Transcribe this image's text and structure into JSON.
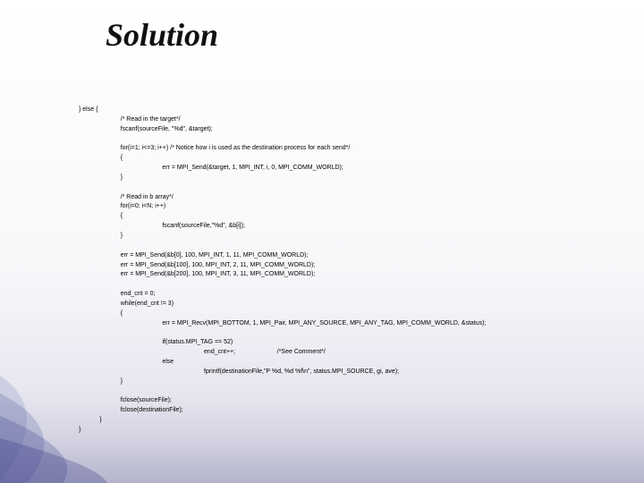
{
  "title": "Solution",
  "code": {
    "l01": "} else {",
    "l02": "/* Read in the target*/",
    "l03": "fscanf(sourceFile, \"%d\", &target);",
    "l04": "for(i=1; i<=3; i++) /* Notice how i is used as the destination process for each send*/",
    "l05": "{",
    "l06": "err = MPI_Send(&target, 1, MPI_INT, i, 0, MPI_COMM_WORLD);",
    "l07": "}",
    "l08": "/* Read in b array*/",
    "l09": "for(i=0; i<N; i++)",
    "l10": "{",
    "l11": "fscanf(sourceFile,\"%d\", &b[i]);",
    "l12": "}",
    "l13": "err = MPI_Send(&b[0], 100, MPI_INT, 1, 11, MPI_COMM_WORLD);",
    "l14": "err = MPI_Send(&b[100], 100, MPI_INT, 2, 11, MPI_COMM_WORLD);",
    "l15": "err = MPI_Send(&b[200], 100, MPI_INT, 3, 11, MPI_COMM_WORLD);",
    "l16": "end_cnt = 0;",
    "l17": "while(end_cnt != 3)",
    "l18": "{",
    "l19": "err = MPI_Recv(MPI_BOTTOM, 1, MPI_Pair, MPI_ANY_SOURCE, MPI_ANY_TAG, MPI_COMM_WORLD, &status);",
    "l20": "if(status.MPI_TAG == 52)",
    "l21": "end_cnt++;",
    "l22": "/*See Comment*/",
    "l23": "else",
    "l24": "fprintf(destinationFile,\"P %d, %d %f\\n\", status.MPI_SOURCE, gi, ave);",
    "l25": "}",
    "l26": "fclose(sourceFile);",
    "l27": "fclose(destinationFile);",
    "l28": "}",
    "l29": "}"
  }
}
